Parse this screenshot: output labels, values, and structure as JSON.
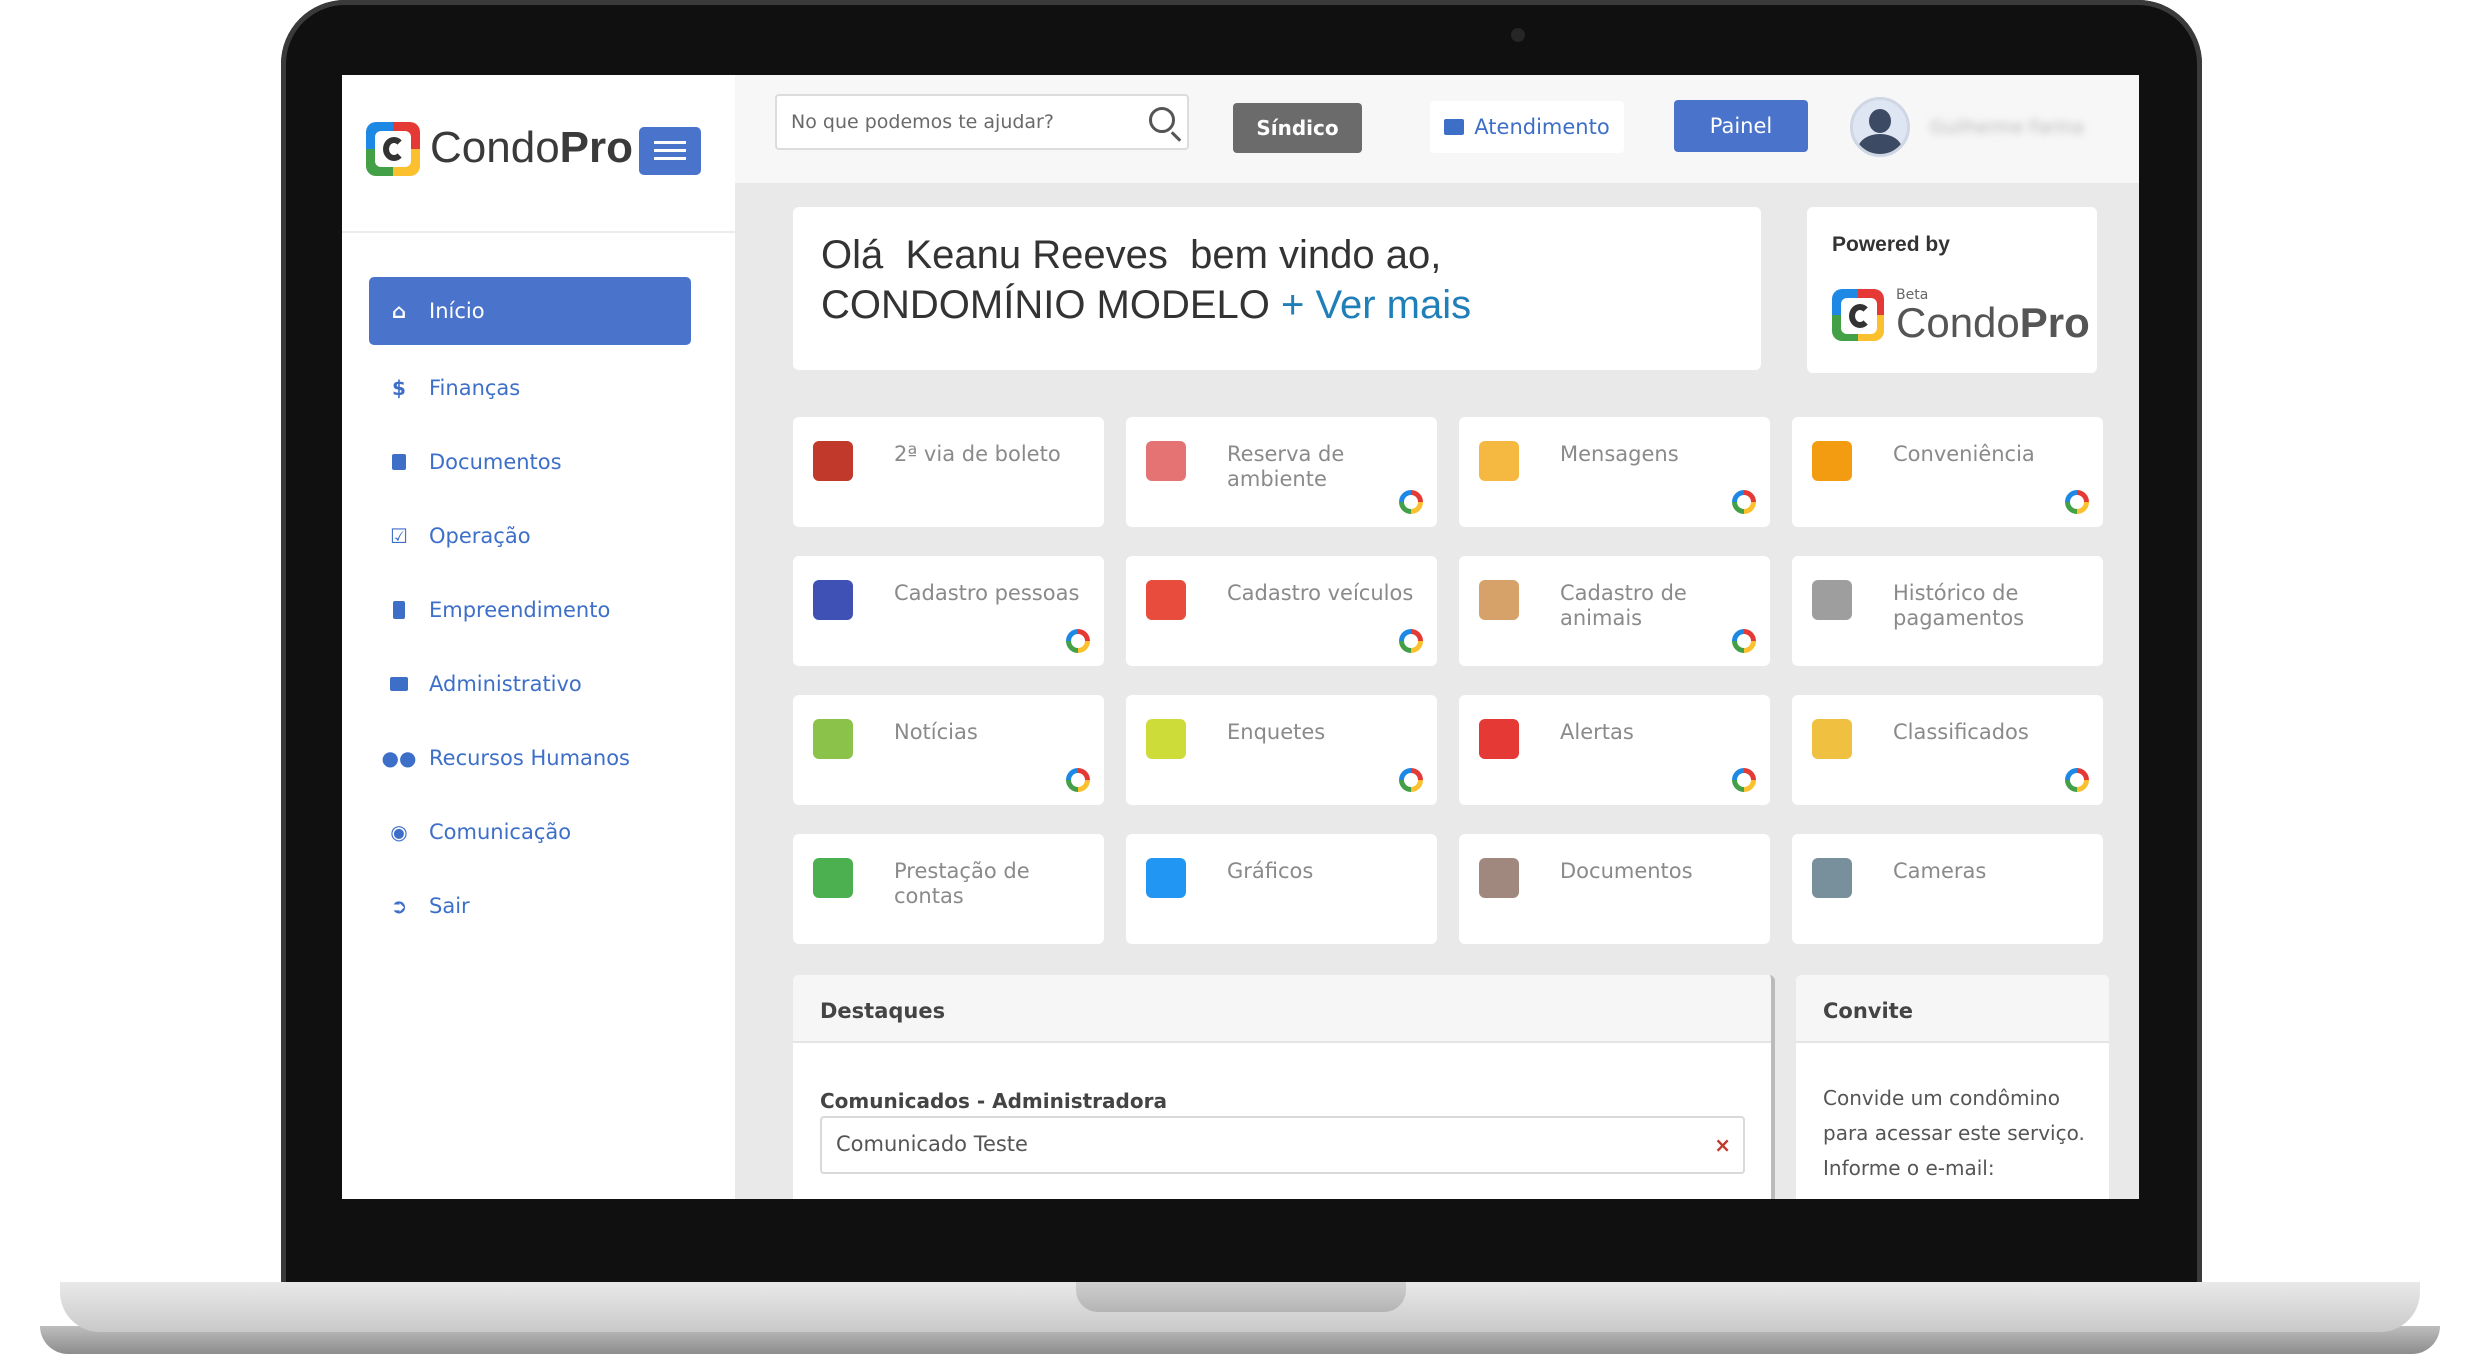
{
  "sidebar": {
    "brand": {
      "name_light": "Condo",
      "name_bold": "Pro"
    },
    "items": [
      {
        "label": "Início",
        "icon": "home-icon",
        "active": true
      },
      {
        "label": "Finanças",
        "icon": "dollar-icon"
      },
      {
        "label": "Documentos",
        "icon": "document-icon"
      },
      {
        "label": "Operação",
        "icon": "checkbox-icon"
      },
      {
        "label": "Empreendimento",
        "icon": "building-icon"
      },
      {
        "label": "Administrativo",
        "icon": "briefcase-icon"
      },
      {
        "label": "Recursos Humanos",
        "icon": "users-icon"
      },
      {
        "label": "Comunicação",
        "icon": "comment-icon"
      },
      {
        "label": "Sair",
        "icon": "sign-out-icon"
      }
    ]
  },
  "topbar": {
    "search_placeholder": "No que podemos te ajudar?",
    "sindico_label": "Síndico",
    "atendimento_label": "Atendimento",
    "painel_label": "Painel",
    "user_name": "Guilherme Farina"
  },
  "welcome": {
    "line1": "Olá  Keanu Reeves  bem vindo ao,",
    "line2": "CONDOMÍNIO MODELO ",
    "link": "+ Ver mais"
  },
  "powered": {
    "label": "Powered by",
    "beta": "Beta",
    "name_light": "Condo",
    "name_bold": "Pro"
  },
  "tiles": [
    {
      "label": "2ª via de boleto",
      "icon": "barcode-icon",
      "color": "#c0392b",
      "loading": false
    },
    {
      "label": "Reserva de ambiente",
      "icon": "calendar-icon",
      "color": "#e57373",
      "loading": true
    },
    {
      "label": "Mensagens",
      "icon": "envelope-icon",
      "color": "#f5b942",
      "loading": true
    },
    {
      "label": "Conveniência",
      "icon": "service-bell-icon",
      "color": "#f39c12",
      "loading": true
    },
    {
      "label": "Cadastro pessoas",
      "icon": "user-add-icon",
      "color": "#3f51b5",
      "loading": true
    },
    {
      "label": "Cadastro veículos",
      "icon": "car-icon",
      "color": "#e74c3c",
      "loading": true
    },
    {
      "label": "Cadastro de animais",
      "icon": "dog-icon",
      "color": "#d7a16a",
      "loading": true
    },
    {
      "label": "Histórico de pagamentos",
      "icon": "receipt-icon",
      "color": "#9e9e9e",
      "loading": false
    },
    {
      "label": "Notícias",
      "icon": "newspaper-icon",
      "color": "#8bc34a",
      "loading": true
    },
    {
      "label": "Enquetes",
      "icon": "checklist-icon",
      "color": "#cddc39",
      "loading": true
    },
    {
      "label": "Alertas",
      "icon": "siren-icon",
      "color": "#e53935",
      "loading": true
    },
    {
      "label": "Classificados",
      "icon": "list-icon",
      "color": "#f0c040",
      "loading": true
    },
    {
      "label": "Prestação de contas",
      "icon": "presentation-icon",
      "color": "#4caf50",
      "loading": false
    },
    {
      "label": "Gráficos",
      "icon": "pie-chart-icon",
      "color": "#2196f3",
      "loading": false
    },
    {
      "label": "Documentos",
      "icon": "folder-search-icon",
      "color": "#a1887f",
      "loading": false
    },
    {
      "label": "Cameras",
      "icon": "camera-icon",
      "color": "#78909c",
      "loading": false
    }
  ],
  "destaques": {
    "title": "Destaques",
    "subtitle": "Comunicados - Administradora",
    "item": "Comunicado Teste",
    "close": "×"
  },
  "convite": {
    "title": "Convite",
    "text": "Convide um condômino para acessar este serviço.",
    "text2": "Informe o e-mail:"
  },
  "colors": {
    "primary": "#4a73cc",
    "link": "#1f7fb8",
    "sindico_bg": "#6b6b6b"
  }
}
